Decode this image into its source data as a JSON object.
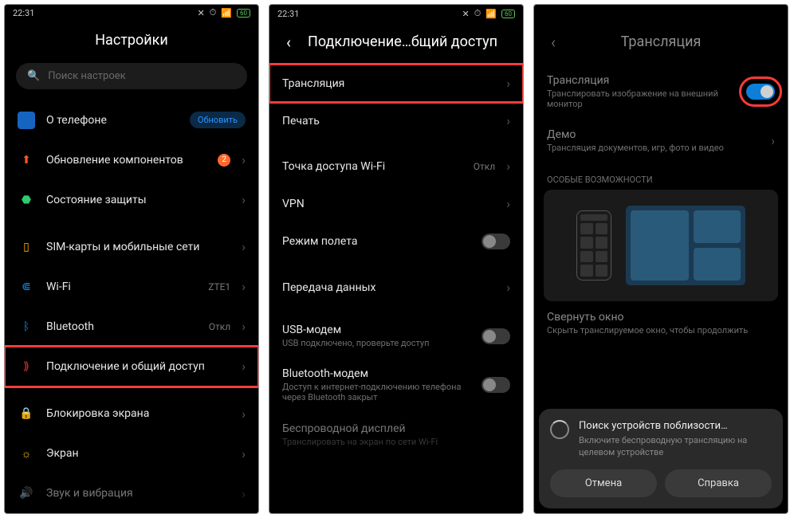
{
  "status": {
    "time": "22:31",
    "battery": "60"
  },
  "s1": {
    "title": "Настройки",
    "search_placeholder": "Поиск настроек",
    "items": {
      "about": {
        "label": "О телефоне",
        "pill": "Обновить"
      },
      "updates": {
        "label": "Обновление компонентов",
        "badge": "2"
      },
      "security": {
        "label": "Состояние защиты"
      },
      "sim": {
        "label": "SIM-карты и мобильные сети"
      },
      "wifi": {
        "label": "Wi-Fi",
        "value": "ZTE1"
      },
      "bt": {
        "label": "Bluetooth",
        "value": "Откл"
      },
      "conn": {
        "label": "Подключение и общий доступ"
      },
      "lock": {
        "label": "Блокировка экрана"
      },
      "display": {
        "label": "Экран"
      },
      "sound": {
        "label": "Звук и вибрация"
      }
    }
  },
  "s2": {
    "title": "Подключение…бщий доступ",
    "items": {
      "cast": {
        "label": "Трансляция"
      },
      "print": {
        "label": "Печать"
      },
      "hotspot": {
        "label": "Точка доступа Wi-Fi",
        "value": "Откл"
      },
      "vpn": {
        "label": "VPN"
      },
      "airplane": {
        "label": "Режим полета"
      },
      "datatransfer": {
        "label": "Передача данных"
      },
      "usb": {
        "label": "USB-модем",
        "sub": "USB подключено, проверьте доступ"
      },
      "btmodem": {
        "label": "Bluetooth-модем",
        "sub": "Доступ к интернет-подключению телефона через Bluetooth закрыт"
      },
      "wdisplay": {
        "label": "Беспроводной дисплей",
        "sub": "Транслировать на экран по сети Wi-Fi"
      }
    }
  },
  "s3": {
    "title": "Трансляция",
    "cast": {
      "label": "Трансляция",
      "sub": "Транслировать изображение на внешний монитор"
    },
    "demo": {
      "label": "Демо",
      "sub": "Трансляция документов, игр, фото и видео"
    },
    "section": "ОСОБЫЕ ВОЗМОЖНОСТИ",
    "minimize": {
      "label": "Свернуть окно",
      "sub": "Скрыть транслируемое окно, чтобы продолжить"
    },
    "dialog": {
      "title": "Поиск устройств поблизости…",
      "sub": "Включите беспроводную трансляцию на целевом устройстве",
      "cancel": "Отмена",
      "help": "Справка"
    }
  }
}
